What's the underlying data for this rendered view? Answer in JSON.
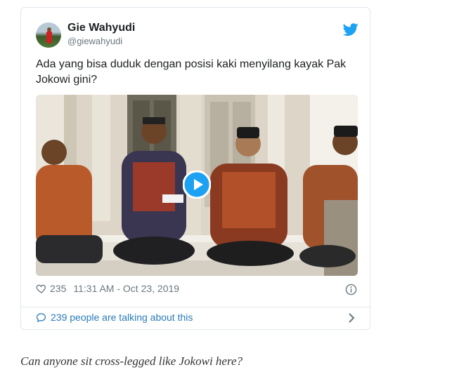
{
  "tweet": {
    "author_name": "Gie Wahyudi",
    "author_handle": "@giewahyudi",
    "text": "Ada yang bisa duduk dengan posisi kaki menyilang kayak Pak Jokowi gini?",
    "like_count": "235",
    "timestamp": "11:31 AM - Oct 23, 2019",
    "conversation_label": "239 people are talking about this",
    "icons": {
      "brand": "twitter-bird-icon",
      "like": "heart-icon",
      "info": "info-icon",
      "conversation": "speech-bubble-icon",
      "chevron": "chevron-right-icon",
      "play": "play-icon"
    },
    "colors": {
      "brand": "#1da1f2",
      "link": "#2b7bb9",
      "muted": "#697882",
      "border": "#e1e8ed"
    }
  },
  "caption": "Can anyone sit cross-legged like Jokowi here?"
}
